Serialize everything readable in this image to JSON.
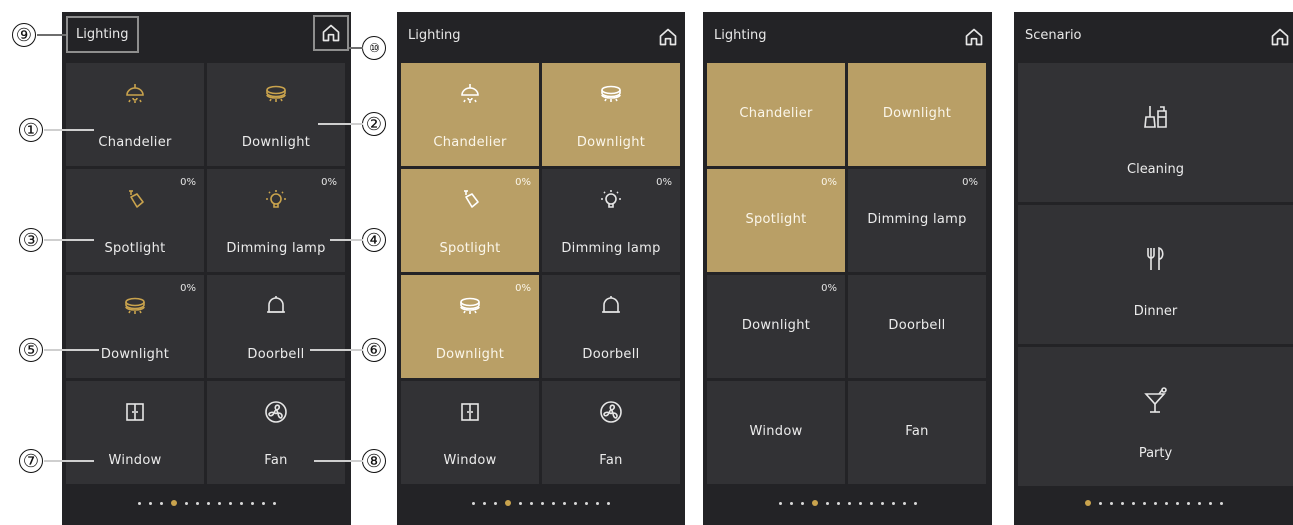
{
  "panel1": {
    "title": "Lighting",
    "tiles": [
      {
        "label": "Chandelier",
        "pct": "",
        "icon": "chandelier"
      },
      {
        "label": "Downlight",
        "pct": "",
        "icon": "downlight"
      },
      {
        "label": "Spotlight",
        "pct": "0%",
        "icon": "spotlight"
      },
      {
        "label": "Dimming lamp",
        "pct": "0%",
        "icon": "bulb"
      },
      {
        "label": "Downlight",
        "pct": "0%",
        "icon": "downlight"
      },
      {
        "label": "Doorbell",
        "pct": "",
        "icon": "bell"
      },
      {
        "label": "Window",
        "pct": "",
        "icon": "window"
      },
      {
        "label": "Fan",
        "pct": "",
        "icon": "fan"
      }
    ]
  },
  "panel2": {
    "title": "Lighting",
    "tiles": [
      {
        "label": "Chandelier",
        "pct": "",
        "icon": "chandelier",
        "on": true
      },
      {
        "label": "Downlight",
        "pct": "",
        "icon": "downlight",
        "on": true
      },
      {
        "label": "Spotlight",
        "pct": "0%",
        "icon": "spotlight",
        "on": true
      },
      {
        "label": "Dimming lamp",
        "pct": "0%",
        "icon": "bulb",
        "on": false
      },
      {
        "label": "Downlight",
        "pct": "0%",
        "icon": "downlight",
        "on": true
      },
      {
        "label": "Doorbell",
        "pct": "",
        "icon": "bell",
        "on": false
      },
      {
        "label": "Window",
        "pct": "",
        "icon": "window",
        "on": false
      },
      {
        "label": "Fan",
        "pct": "",
        "icon": "fan",
        "on": false
      }
    ]
  },
  "panel3": {
    "title": "Lighting",
    "tiles": [
      {
        "label": "Chandelier",
        "pct": "",
        "on": true
      },
      {
        "label": "Downlight",
        "pct": "",
        "on": true
      },
      {
        "label": "Spotlight",
        "pct": "0%",
        "on": true
      },
      {
        "label": "Dimming lamp",
        "pct": "0%",
        "on": false
      },
      {
        "label": "Downlight",
        "pct": "0%",
        "on": false
      },
      {
        "label": "Doorbell",
        "pct": "",
        "on": false
      },
      {
        "label": "Window",
        "pct": "",
        "on": false
      },
      {
        "label": "Fan",
        "pct": "",
        "on": false
      }
    ]
  },
  "panel4": {
    "title": "Scenario",
    "scenes": [
      {
        "label": "Cleaning",
        "icon": "cleaning"
      },
      {
        "label": "Dinner",
        "icon": "dinner"
      },
      {
        "label": "Party",
        "icon": "party"
      }
    ]
  },
  "pagination": {
    "count": 13,
    "panel1_active": 3,
    "panel2_active": 3,
    "panel3_active": 3,
    "panel4_active": 0
  },
  "callouts": [
    "①",
    "②",
    "③",
    "④",
    "⑤",
    "⑥",
    "⑦",
    "⑧",
    "⑨",
    "⑩"
  ],
  "colors": {
    "panel_bg": "#232326",
    "tile_bg": "#323235",
    "tile_on": "#b99f66",
    "accent_icon": "#c9a34d",
    "icon_white": "#e6e6e6"
  }
}
